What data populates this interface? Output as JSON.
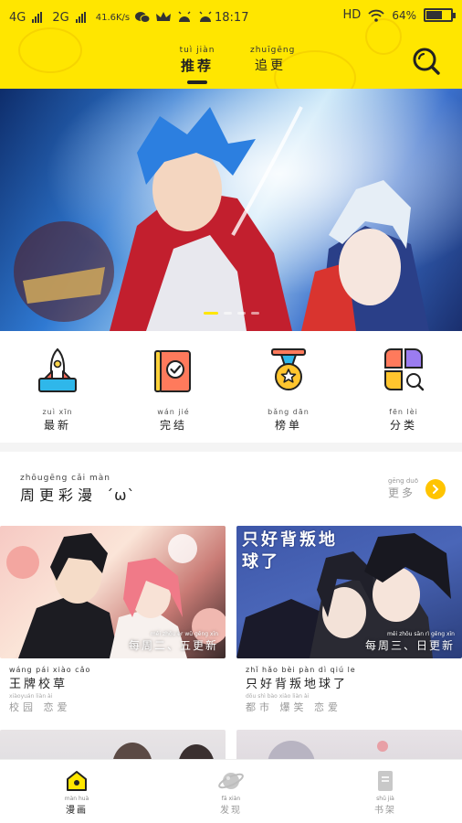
{
  "status_bar": {
    "network1": "4G",
    "network2": "2G",
    "speed": "41.6K/s",
    "time": "18:17",
    "hd": "HD",
    "battery": "64%",
    "battery_level": 0.64
  },
  "header": {
    "tabs": [
      {
        "pinyin": "tuì jiàn",
        "label": "推荐",
        "active": true
      },
      {
        "pinyin": "zhuīgēng",
        "label": "追更",
        "active": false
      }
    ]
  },
  "quick_menu": [
    {
      "pinyin": "zuì  xīn",
      "label": "最新",
      "icon": "rocket-icon"
    },
    {
      "pinyin": "wán  jié",
      "label": "完结",
      "icon": "book-check-icon"
    },
    {
      "pinyin": "bǎng dān",
      "label": "榜单",
      "icon": "medal-icon"
    },
    {
      "pinyin": "fēn  lèi",
      "label": "分类",
      "icon": "category-grid-icon"
    }
  ],
  "section": {
    "pinyin": "zhōugēng cǎi màn",
    "title": "周更彩漫",
    "emoticon": "´ω`",
    "more_pinyin": "gēng duō",
    "more_label": "更多"
  },
  "comics": [
    {
      "cover_title": "",
      "update_pinyin": "měi zhōu èr   wǔ gēng xīn",
      "update": "每周二、五更新",
      "title_pinyin": "wáng pái xiào cǎo",
      "title": "王牌校草",
      "tags_pinyin": "xiàoyuán   liàn ài",
      "tags": "校园 恋爱"
    },
    {
      "cover_title": "只好背叛地球了",
      "update_pinyin": "měi zhōu sān   rì gēng xīn",
      "update": "每周三、日更新",
      "title_pinyin": "zhǐ hǎo bèi pàn dì qiú le",
      "title": "只好背叛地球了",
      "tags_pinyin": "dōu shì  bào xiào  liàn ài",
      "tags": "都市 爆笑 恋爱"
    }
  ],
  "bottom_nav": [
    {
      "pinyin": "màn huà",
      "label": "漫画",
      "icon": "home-icon",
      "active": true
    },
    {
      "pinyin": "fā xiàn",
      "label": "发现",
      "icon": "planet-icon",
      "active": false
    },
    {
      "pinyin": "shū jià",
      "label": "书架",
      "icon": "bookshelf-icon",
      "active": false
    }
  ],
  "colors": {
    "brand_yellow": "#ffe600",
    "more_button": "#ffc400"
  }
}
